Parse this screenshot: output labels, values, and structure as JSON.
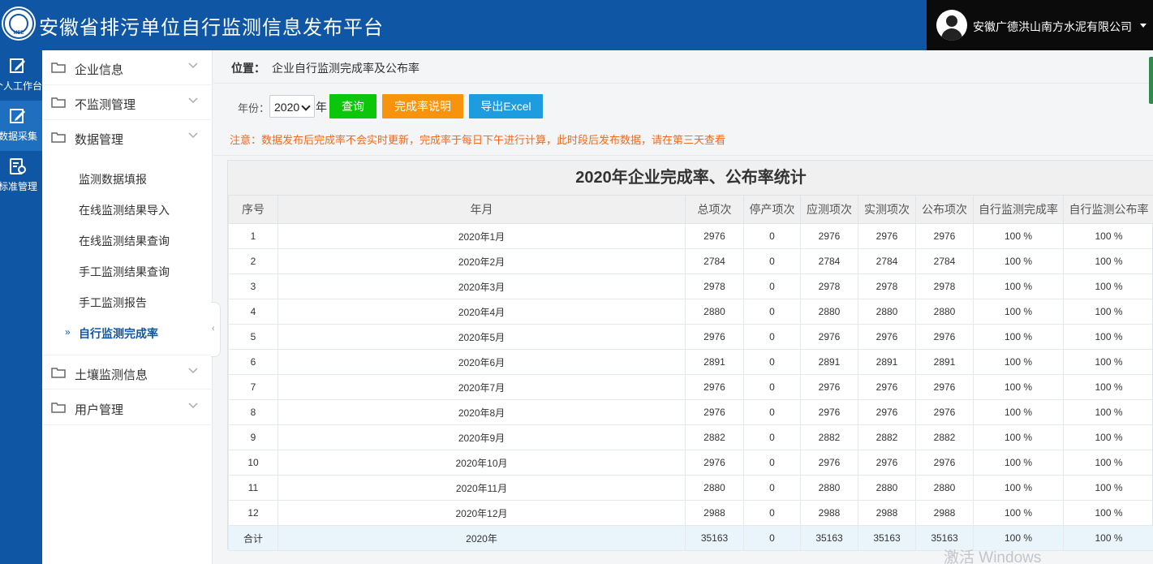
{
  "header": {
    "logo_text": "MEE",
    "title": "安徽省排污单位自行监测信息发布平台",
    "user": {
      "company": "安徽广德洪山南方水泥有限公司"
    }
  },
  "rail": [
    {
      "label": "个人工作台",
      "icon": "edit-icon"
    },
    {
      "label": "数据采集",
      "icon": "pencil-icon"
    },
    {
      "label": "标准管理",
      "icon": "standard-doc-icon"
    }
  ],
  "menu": {
    "groups_top": [
      "企业信息",
      "不监测管理",
      "数据管理"
    ],
    "sub_items": [
      "监测数据填报",
      "在线监测结果导入",
      "在线监测结果查询",
      "手工监测结果查询",
      "手工监测报告",
      "自行监测完成率"
    ],
    "active_marker": "»",
    "groups_bottom": [
      "土壤监测信息",
      "用户管理"
    ]
  },
  "breadcrumb": {
    "label": "位置：",
    "value": "企业自行监测完成率及公布率"
  },
  "filter": {
    "year_label": "年份：",
    "year_value": "2020",
    "year_unit": "年",
    "query": "查询",
    "explain": "完成率说明",
    "export": "导出Excel"
  },
  "notice": "注意：数据发布后完成率不会实时更新，完成率于每日下午进行计算，此时段后发布数据，请在第三天查看",
  "table": {
    "title": "2020年企业完成率、公布率统计",
    "headers": [
      "序号",
      "年月",
      "总项次",
      "停产项次",
      "应测项次",
      "实测项次",
      "公布项次",
      "自行监测完成率",
      "自行监测公布率"
    ],
    "rows": [
      [
        "1",
        "2020年1月",
        "2976",
        "0",
        "2976",
        "2976",
        "2976",
        "100 %",
        "100 %"
      ],
      [
        "2",
        "2020年2月",
        "2784",
        "0",
        "2784",
        "2784",
        "2784",
        "100 %",
        "100 %"
      ],
      [
        "3",
        "2020年3月",
        "2978",
        "0",
        "2978",
        "2978",
        "2978",
        "100 %",
        "100 %"
      ],
      [
        "4",
        "2020年4月",
        "2880",
        "0",
        "2880",
        "2880",
        "2880",
        "100 %",
        "100 %"
      ],
      [
        "5",
        "2020年5月",
        "2976",
        "0",
        "2976",
        "2976",
        "2976",
        "100 %",
        "100 %"
      ],
      [
        "6",
        "2020年6月",
        "2891",
        "0",
        "2891",
        "2891",
        "2891",
        "100 %",
        "100 %"
      ],
      [
        "7",
        "2020年7月",
        "2976",
        "0",
        "2976",
        "2976",
        "2976",
        "100 %",
        "100 %"
      ],
      [
        "8",
        "2020年8月",
        "2976",
        "0",
        "2976",
        "2976",
        "2976",
        "100 %",
        "100 %"
      ],
      [
        "9",
        "2020年9月",
        "2882",
        "0",
        "2882",
        "2882",
        "2882",
        "100 %",
        "100 %"
      ],
      [
        "10",
        "2020年10月",
        "2976",
        "0",
        "2976",
        "2976",
        "2976",
        "100 %",
        "100 %"
      ],
      [
        "11",
        "2020年11月",
        "2880",
        "0",
        "2880",
        "2880",
        "2880",
        "100 %",
        "100 %"
      ],
      [
        "12",
        "2020年12月",
        "2988",
        "0",
        "2988",
        "2988",
        "2988",
        "100 %",
        "100 %"
      ]
    ],
    "total": [
      "合计",
      "2020年",
      "35163",
      "0",
      "35163",
      "35163",
      "35163",
      "100 %",
      "100 %"
    ]
  },
  "watermark": "激活 Windows"
}
